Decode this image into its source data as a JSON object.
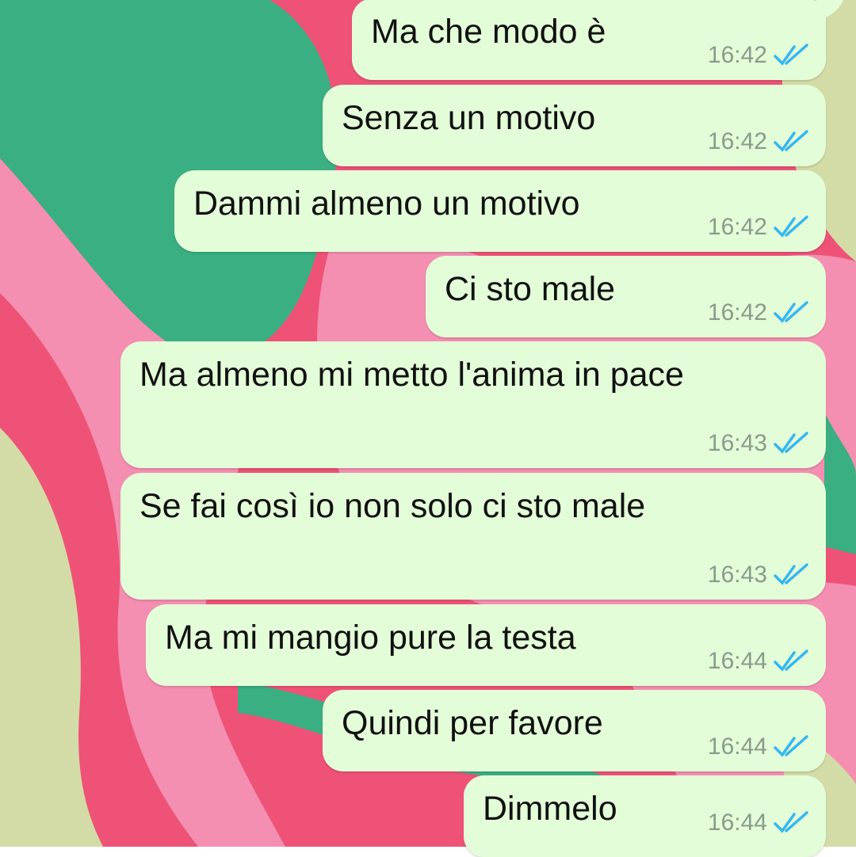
{
  "messages": [
    {
      "text": "Ma che modo è",
      "time": "16:42",
      "status_icon": "double-check-read-icon"
    },
    {
      "text": "Senza un motivo",
      "time": "16:42",
      "status_icon": "double-check-read-icon"
    },
    {
      "text": "Dammi almeno un motivo",
      "time": "16:42",
      "status_icon": "double-check-read-icon"
    },
    {
      "text": "Ci sto male",
      "time": "16:42",
      "status_icon": "double-check-read-icon"
    },
    {
      "text": "Ma almeno mi metto l'anima in pace",
      "time": "16:43",
      "status_icon": "double-check-read-icon"
    },
    {
      "text": "Se fai così io non solo ci sto male",
      "time": "16:43",
      "status_icon": "double-check-read-icon"
    },
    {
      "text": "Ma mi mangio pure la testa",
      "time": "16:44",
      "status_icon": "double-check-read-icon"
    },
    {
      "text": "Quindi per favore",
      "time": "16:44",
      "status_icon": "double-check-read-icon"
    },
    {
      "text": "Dimmelo",
      "time": "16:44",
      "status_icon": "double-check-read-icon"
    }
  ],
  "colors": {
    "bubble_out": "#e3fdd8",
    "read_tick": "#34b7f1",
    "wallpaper_green": "#3aaf82",
    "wallpaper_pink": "#f48fb1",
    "wallpaper_red": "#ef5277",
    "wallpaper_cream": "#d3dca7"
  }
}
